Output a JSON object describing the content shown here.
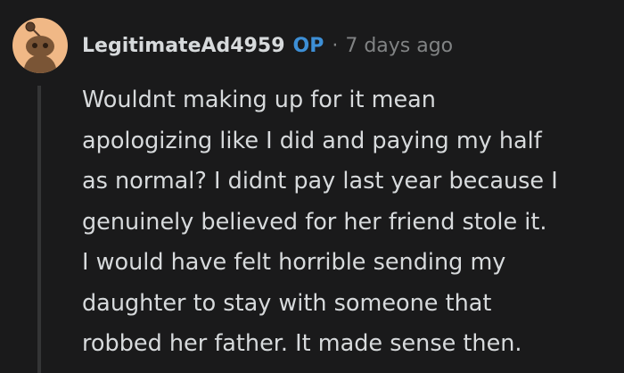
{
  "comment": {
    "author": "LegitimateAd4959",
    "badge": "OP",
    "separator": "·",
    "timestamp": "7 days ago",
    "avatar_icon": "reddit-snoo-avatar",
    "body": "Wouldnt making up for it mean\napologizing like I did and paying my half\nas normal? I didnt pay last year because I\ngenuinely believed for her friend stole it.\nI would have felt horrible sending my\ndaughter to stay with someone that\nrobbed her father. It made sense then."
  },
  "colors": {
    "background": "#1a1a1b",
    "text": "#d7dadc",
    "muted": "#818384",
    "op_badge": "#3d8fd6",
    "avatar_bg": "#f0b886",
    "thread_line": "#343536"
  }
}
